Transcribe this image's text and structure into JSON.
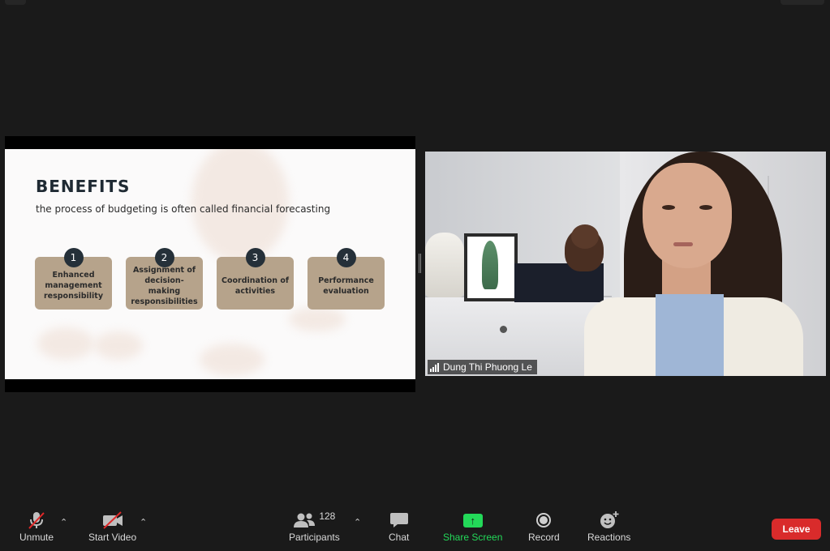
{
  "slide": {
    "title": "BENEFITS",
    "subtitle": "the process of budgeting is often called financial forecasting",
    "benefits": [
      {
        "number": "1",
        "text": "Enhanced management responsibility"
      },
      {
        "number": "2",
        "text": "Assignment of decision-making responsibilities"
      },
      {
        "number": "3",
        "text": "Coordination of activities"
      },
      {
        "number": "4",
        "text": "Performance evaluation"
      }
    ]
  },
  "video": {
    "participant_name": "Dung Thi Phuong Le"
  },
  "toolbar": {
    "unmute_label": "Unmute",
    "start_video_label": "Start Video",
    "participants_label": "Participants",
    "participants_count": "128",
    "chat_label": "Chat",
    "share_screen_label": "Share Screen",
    "record_label": "Record",
    "reactions_label": "Reactions",
    "leave_label": "Leave"
  },
  "colors": {
    "background": "#1a1a1a",
    "share_screen_green": "#23d959",
    "leave_red": "#d92b2b",
    "mute_slash_red": "#e02828",
    "benefit_card": "#b6a38b",
    "benefit_number_bg": "#253039"
  }
}
